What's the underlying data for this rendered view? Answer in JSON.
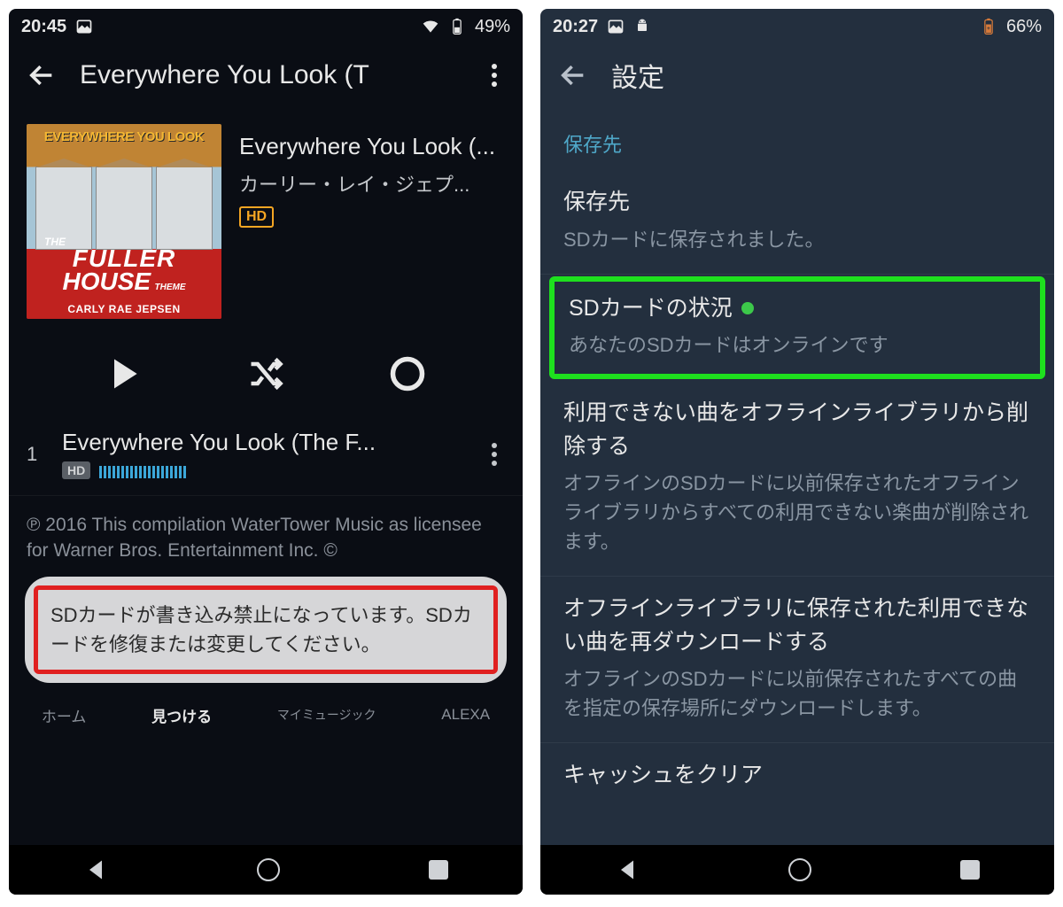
{
  "left": {
    "status": {
      "time": "20:45",
      "battery": "49%"
    },
    "appbar_title": "Everywhere You Look (T",
    "album": {
      "banner": "EVERYWHERE YOU LOOK",
      "logo_the": "THE",
      "logo_line1": "FULLER",
      "logo_line2": "HOUSE",
      "logo_theme": "THEME",
      "artist_bar": "CARLY RAE JEPSEN",
      "title": "Everywhere You Look (...",
      "artist": "カーリー・レイ・ジェプ...",
      "hd": "HD"
    },
    "track": {
      "num": "1",
      "title": "Everywhere You Look (The F...",
      "hd": "HD"
    },
    "copyright": "℗ 2016 This compilation WaterTower Music as licensee for Warner Bros. Entertainment Inc. ©",
    "toast": "SDカードが書き込み禁止になっています。SDカードを修復または変更してください。",
    "tabs": {
      "home": "ホーム",
      "find": "見つける",
      "mymusic": "マイミュージック",
      "alexa": "ALEXA"
    }
  },
  "right": {
    "status": {
      "time": "20:27",
      "battery": "66%"
    },
    "appbar_title": "設定",
    "section": "保存先",
    "items": [
      {
        "title": "保存先",
        "sub": "SDカードに保存されました。"
      },
      {
        "title": "SDカードの状況",
        "sub": "あなたのSDカードはオンラインです"
      },
      {
        "title": "利用できない曲をオフラインライブラリから削除する",
        "sub": "オフラインのSDカードに以前保存されたオフラインライブラリからすべての利用できない楽曲が削除されます。"
      },
      {
        "title": "オフラインライブラリに保存された利用できない曲を再ダウンロードする",
        "sub": "オフラインのSDカードに以前保存されたすべての曲を指定の保存場所にダウンロードします。"
      },
      {
        "title": "キャッシュをクリア",
        "sub": ""
      }
    ]
  }
}
